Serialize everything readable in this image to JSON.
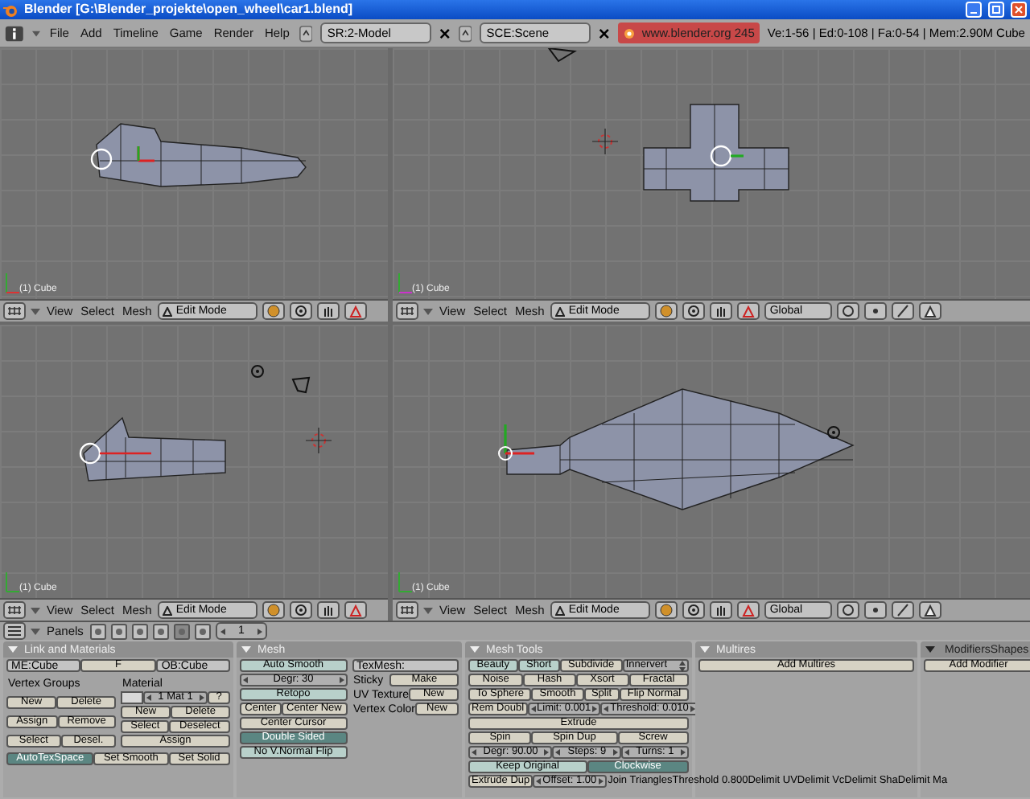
{
  "window": {
    "title": "Blender [G:\\Blender_projekte\\open_wheel\\car1.blend]"
  },
  "menu_bar": {
    "menus": [
      "File",
      "Add",
      "Timeline",
      "Game",
      "Render",
      "Help"
    ],
    "screen": "SR:2-Model",
    "scene": "SCE:Scene",
    "url": "www.blender.org 245",
    "stats": "Ve:1-56 | Ed:0-108 | Fa:0-54 | Mem:2.90M Cube"
  },
  "viewports": [
    {
      "label": "(1) Cube",
      "menus": [
        "View",
        "Select",
        "Mesh"
      ],
      "mode": "Edit Mode"
    },
    {
      "label": "(1) Cube",
      "menus": [
        "View",
        "Select",
        "Mesh"
      ],
      "mode": "Edit Mode",
      "orientation": "Global"
    },
    {
      "label": "(1) Cube",
      "menus": [
        "View",
        "Select",
        "Mesh"
      ],
      "mode": "Edit Mode"
    },
    {
      "label": "(1) Cube",
      "menus": [
        "View",
        "Select",
        "Mesh"
      ],
      "mode": "Edit Mode",
      "orientation": "Global"
    }
  ],
  "buttons_header": {
    "menu": "Panels",
    "frame": "1"
  },
  "panels": [
    {
      "title": "Link and Materials",
      "sections": [
        {
          "columns": [
            [
              [
                {
                  "kind": "field",
                  "text": "ME:Cube"
                },
                {
                  "kind": "button",
                  "text": "F"
                },
                {
                  "kind": "field",
                  "text": "OB:Cube"
                }
              ]
            ]
          ]
        },
        {
          "columns": [
            [
              [
                {
                  "kind": "text",
                  "text": "Vertex Groups"
                }
              ],
              [
                {
                  "kind": "button",
                  "text": "New"
                },
                {
                  "kind": "button",
                  "text": "Delete"
                }
              ],
              [
                {
                  "kind": "button",
                  "text": "Assign"
                },
                {
                  "kind": "button",
                  "text": "Remove"
                }
              ],
              [
                {
                  "kind": "button",
                  "text": "Select"
                },
                {
                  "kind": "button",
                  "text": "Desel."
                }
              ]
            ],
            [
              [
                {
                  "kind": "text",
                  "text": "Material"
                }
              ],
              [
                {
                  "kind": "swatch"
                },
                {
                  "kind": "num",
                  "text": "1 Mat 1"
                },
                {
                  "kind": "button",
                  "text": "?"
                }
              ],
              [
                {
                  "kind": "button",
                  "text": "New"
                },
                {
                  "kind": "button",
                  "text": "Delete"
                }
              ],
              [
                {
                  "kind": "button",
                  "text": "Select"
                },
                {
                  "kind": "button",
                  "text": "Deselect"
                }
              ],
              [
                {
                  "kind": "button",
                  "text": "Assign"
                }
              ]
            ]
          ]
        },
        {
          "columns": [
            [
              [
                {
                  "kind": "toggle",
                  "text": "AutoTexSpace",
                  "on": true
                },
                {
                  "kind": "button",
                  "text": "Set Smooth"
                },
                {
                  "kind": "button",
                  "text": "Set Solid"
                }
              ]
            ]
          ]
        }
      ]
    },
    {
      "title": "Mesh",
      "sections": [
        {
          "columns": [
            [
              [
                {
                  "kind": "toggle",
                  "text": "Auto Smooth",
                  "on": false
                }
              ],
              [
                {
                  "kind": "num",
                  "text": "Degr: 30"
                }
              ],
              [
                {
                  "kind": "toggle",
                  "text": "Retopo",
                  "on": false
                }
              ],
              [
                {
                  "kind": "button",
                  "text": "Center"
                },
                {
                  "kind": "button",
                  "text": "Center New"
                }
              ],
              [
                {
                  "kind": "button",
                  "text": "Center Cursor"
                }
              ],
              [
                {
                  "kind": "toggle",
                  "text": "Double Sided",
                  "on": true
                }
              ],
              [
                {
                  "kind": "toggle",
                  "text": "No V.Normal Flip",
                  "on": false
                }
              ]
            ],
            [
              [
                {
                  "kind": "field",
                  "text": "TexMesh:"
                }
              ],
              [
                {
                  "kind": "text",
                  "text": "Sticky"
                },
                {
                  "kind": "button",
                  "text": "Make"
                }
              ],
              [
                {
                  "kind": "text",
                  "text": "UV Texture"
                },
                {
                  "kind": "button",
                  "text": "New"
                }
              ],
              [
                {
                  "kind": "text",
                  "text": "Vertex Color"
                },
                {
                  "kind": "button",
                  "text": "New"
                }
              ]
            ]
          ]
        }
      ]
    },
    {
      "title": "Mesh Tools",
      "sections": [
        {
          "columns": [
            [
              [
                {
                  "kind": "toggle",
                  "text": "Beauty",
                  "on": false
                },
                {
                  "kind": "toggle",
                  "text": "Short",
                  "on": false
                },
                {
                  "kind": "button",
                  "text": "Subdivide"
                },
                {
                  "kind": "menu",
                  "text": "Innervert"
                }
              ],
              [
                {
                  "kind": "button",
                  "text": "Noise"
                },
                {
                  "kind": "button",
                  "text": "Hash"
                },
                {
                  "kind": "button",
                  "text": "Xsort"
                },
                {
                  "kind": "button",
                  "text": "Fractal"
                }
              ],
              [
                {
                  "kind": "button",
                  "text": "To Sphere"
                },
                {
                  "kind": "button",
                  "text": "Smooth"
                },
                {
                  "kind": "button",
                  "text": "Split"
                },
                {
                  "kind": "button",
                  "text": "Flip Normal"
                }
              ],
              [
                {
                  "kind": "button",
                  "text": "Rem Doubl"
                },
                {
                  "kind": "num",
                  "text": "Limit: 0.001"
                },
                {
                  "kind": "num",
                  "text": "Threshold: 0.010"
                }
              ],
              [
                {
                  "kind": "button",
                  "text": "Extrude"
                }
              ],
              [
                {
                  "kind": "button",
                  "text": "Spin"
                },
                {
                  "kind": "button",
                  "text": "Spin Dup"
                },
                {
                  "kind": "button",
                  "text": "Screw"
                }
              ],
              [
                {
                  "kind": "num",
                  "text": "Degr: 90.00"
                },
                {
                  "kind": "num",
                  "text": "Steps: 9"
                },
                {
                  "kind": "num",
                  "text": "Turns: 1"
                }
              ],
              [
                {
                  "kind": "toggle",
                  "text": "Keep Original",
                  "on": false
                },
                {
                  "kind": "toggle",
                  "text": "Clockwise",
                  "on": true
                }
              ],
              [
                {
                  "kind": "button",
                  "text": "Extrude Dup"
                },
                {
                  "kind": "num",
                  "text": "Offset: 1.00"
                },
                {
                  "kind": "overflow",
                  "text": "Join TrianglesThreshold 0.800Delimit UVDelimit VcDelimit ShaDelimit Ma"
                }
              ]
            ]
          ]
        }
      ]
    },
    {
      "title": "Multires",
      "sections": [
        {
          "columns": [
            [
              [
                {
                  "kind": "button",
                  "text": "Add Multires"
                }
              ]
            ]
          ]
        }
      ]
    },
    {
      "tabs": [
        "Modifiers",
        "Shapes"
      ],
      "sections": [
        {
          "columns": [
            [
              [
                {
                  "kind": "button",
                  "text": "Add Modifier"
                }
              ]
            ]
          ]
        }
      ]
    }
  ]
}
